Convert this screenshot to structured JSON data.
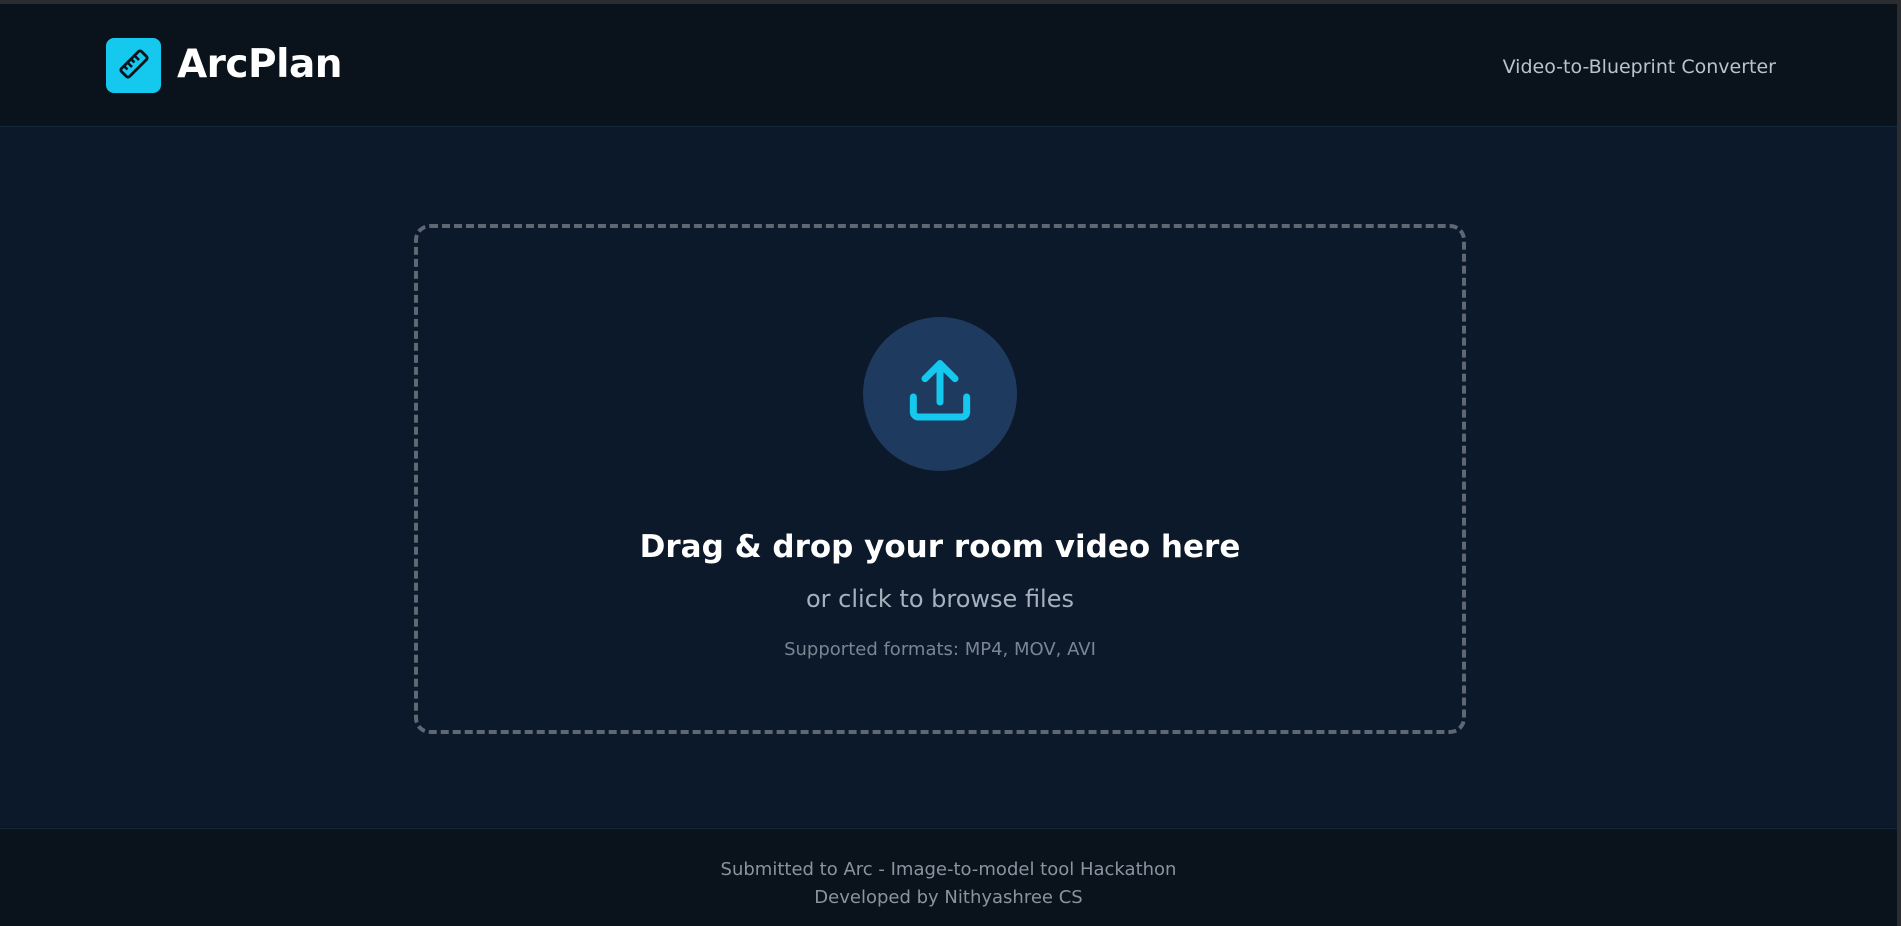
{
  "header": {
    "brand": "ArcPlan",
    "logo_icon": "ruler-icon",
    "tagline": "Video-to-Blueprint Converter"
  },
  "dropzone": {
    "icon": "upload-icon",
    "title": "Drag & drop your room video here",
    "subtitle": "or click to browse files",
    "formats": "Supported formats: MP4, MOV, AVI"
  },
  "footer": {
    "line1": "Submitted to Arc - Image-to-model tool Hackathon",
    "line2": "Developed by Nithyashree CS"
  },
  "colors": {
    "accent": "#14c8ee",
    "background": "#0b192a",
    "header_bg": "#0a121c",
    "upload_circle": "#1f3a5f",
    "dashed_border": "#5e6772"
  }
}
